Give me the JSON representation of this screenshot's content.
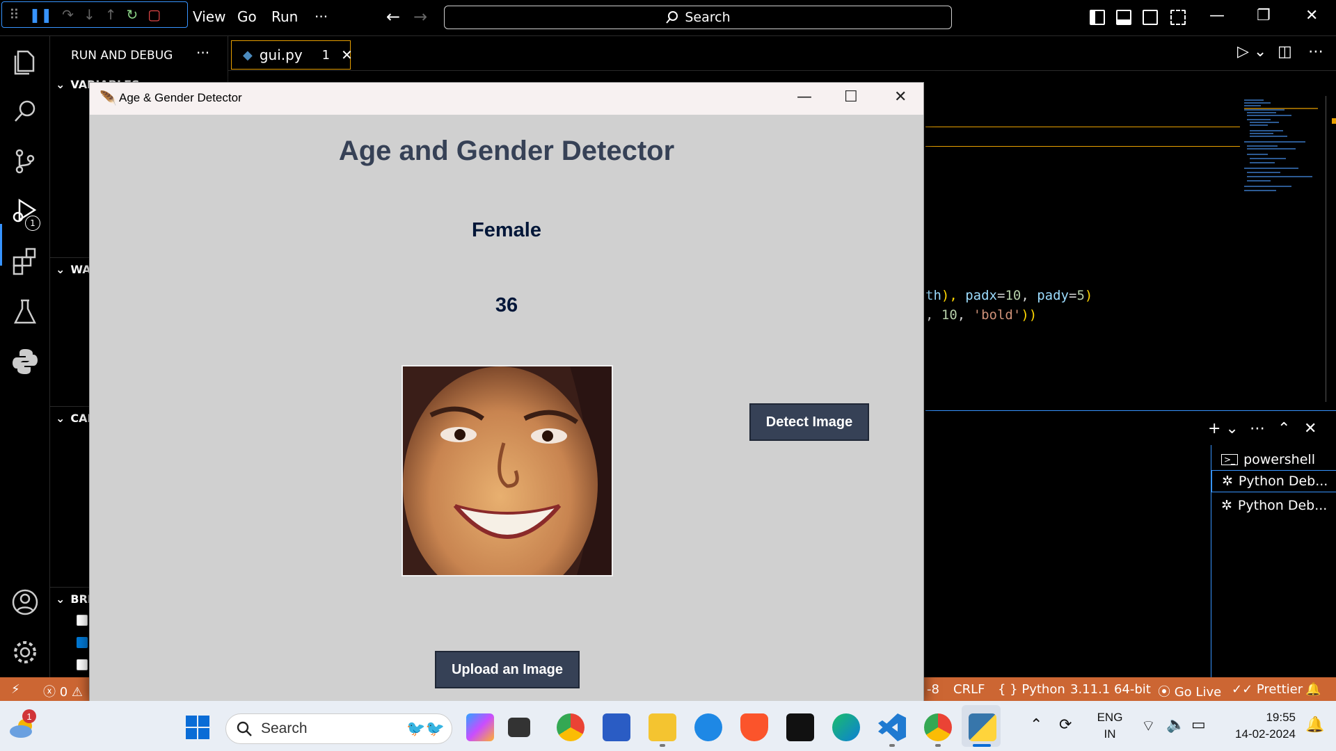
{
  "vscode": {
    "menu": [
      "View",
      "Go",
      "Run",
      "···"
    ],
    "command_center_placeholder": "Search",
    "sidebar": {
      "title": "RUN AND DEBUG",
      "more": "···",
      "sections": [
        "VARIABLES",
        "WATCH",
        "CALL STACK",
        "BREAKPOINTS"
      ],
      "breakpoints_checked": [
        false,
        true,
        false
      ]
    },
    "debug_badge": "1",
    "tab": {
      "name": "gui.py",
      "count": "1"
    },
    "code_lines": [
      {
        "parts": [
          [
            "th",
            "#9cdcfe"
          ],
          [
            "), ",
            "#ffd700"
          ],
          [
            "padx",
            "#9cdcfe"
          ],
          [
            "=",
            "#d4d4d4"
          ],
          [
            "10",
            "#b5cea8"
          ],
          [
            ", ",
            "#d4d4d4"
          ],
          [
            "pady",
            "#9cdcfe"
          ],
          [
            "=",
            "#d4d4d4"
          ],
          [
            "5",
            "#b5cea8"
          ],
          [
            ")",
            "#ffd700"
          ]
        ]
      },
      {
        "parts": [
          [
            ", ",
            "#d4d4d4"
          ],
          [
            "10",
            "#b5cea8"
          ],
          [
            ", ",
            "#d4d4d4"
          ],
          [
            "'bold'",
            "#ce9178"
          ],
          [
            "))",
            "#ffd700"
          ]
        ]
      }
    ],
    "terminals": [
      "powershell",
      "Python Deb...",
      "Python Deb..."
    ],
    "status": {
      "errors": "0",
      "eol": "CRLF",
      "language": "Python",
      "interpreter": "3.11.1 64-bit",
      "go_live": "Go Live",
      "prettier": "Prettier",
      "encoding_tail": "-8"
    }
  },
  "tk_app": {
    "window_title": "Age & Gender Detector",
    "heading": "Age and Gender Detector",
    "gender_label": "Female",
    "age_label": "36",
    "detect_button": "Detect Image",
    "upload_button": "Upload an Image"
  },
  "taskbar": {
    "search_placeholder": "Search",
    "weather_badge": "1",
    "language": "ENG",
    "region": "IN",
    "time": "19:55",
    "date": "14-02-2024"
  },
  "colors": {
    "status_bar": "#cc6633",
    "accent_blue": "#3794ff",
    "tk_button": "#364156",
    "tk_background": "#d0d0d0",
    "tk_text": "#011638"
  }
}
